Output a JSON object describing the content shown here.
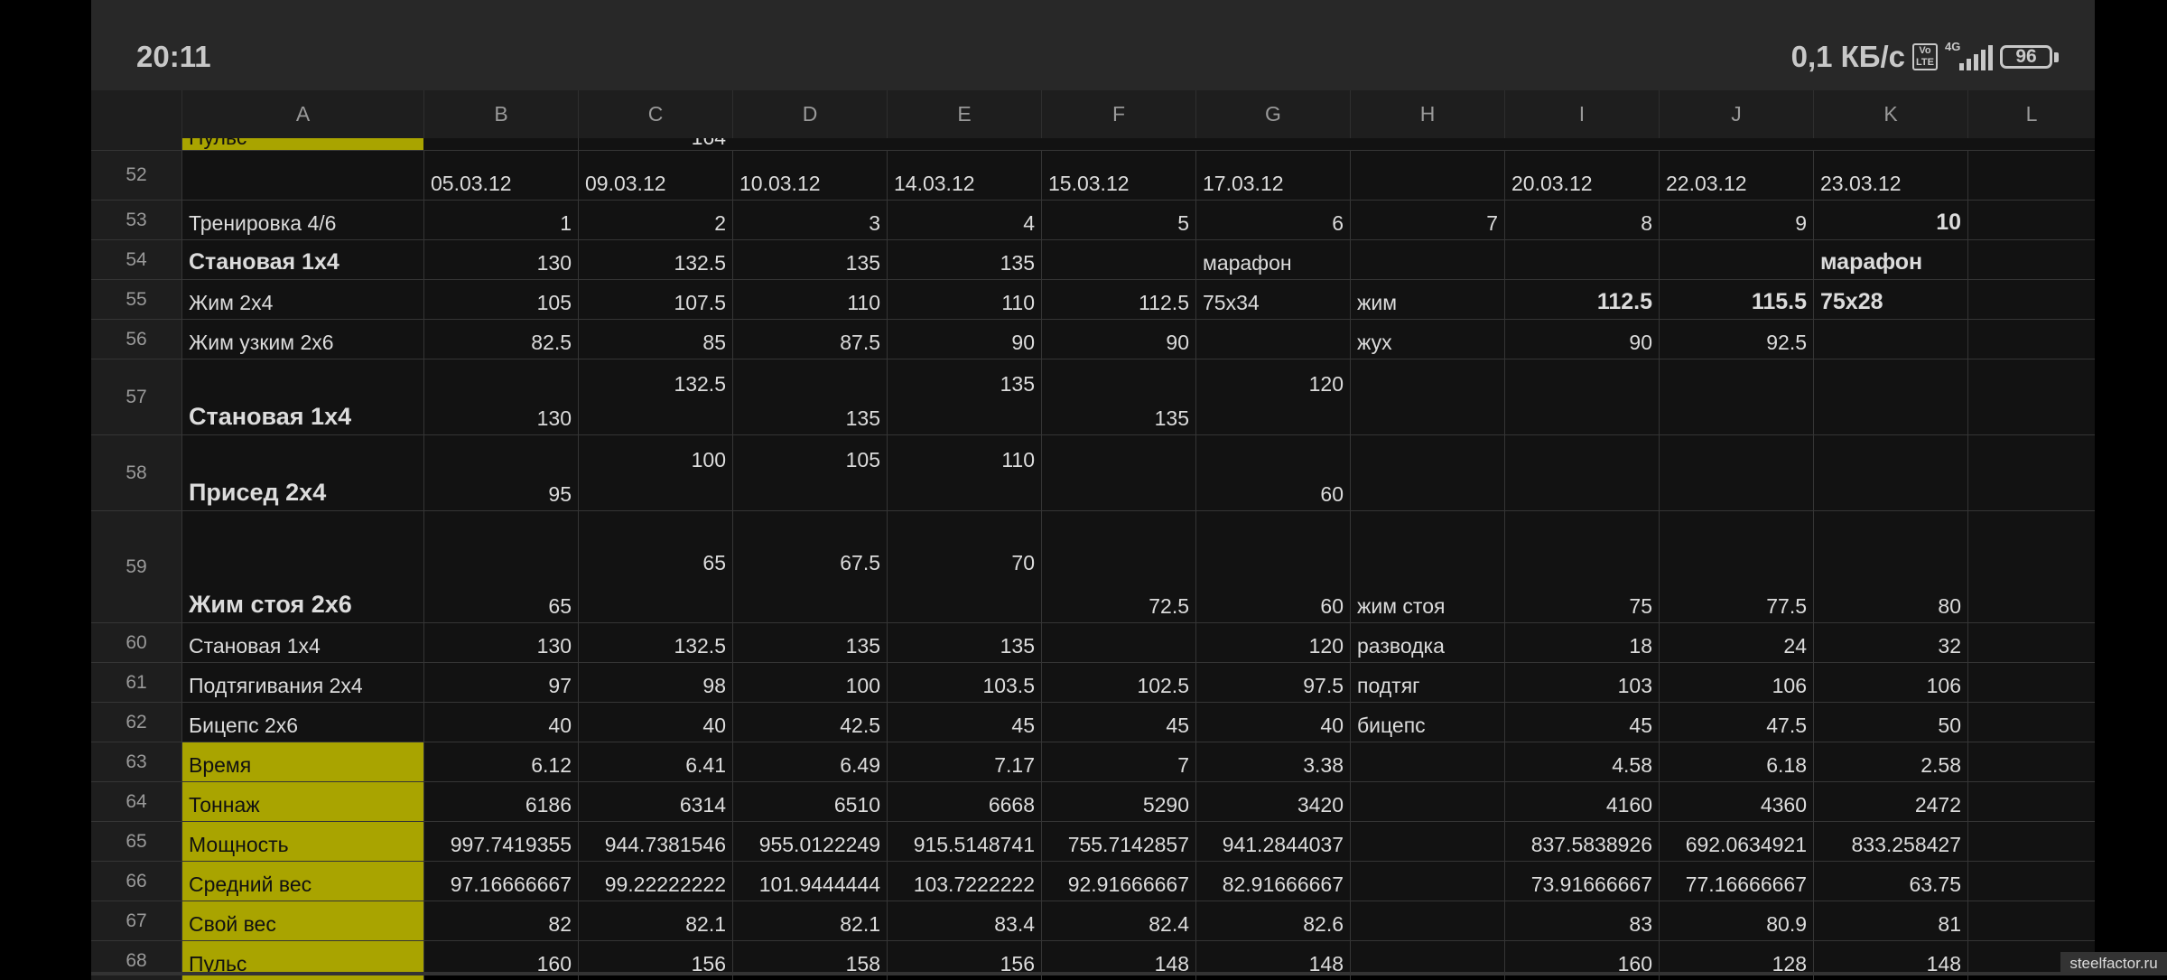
{
  "status": {
    "time": "20:11",
    "net_speed": "0,1 КБ/с",
    "volte": "Vo LTE",
    "network": "4G",
    "battery": "96"
  },
  "sheet": {
    "columns": [
      "A",
      "B",
      "C",
      "D",
      "E",
      "F",
      "G",
      "H",
      "I",
      "J",
      "K",
      "L"
    ],
    "partial_row": {
      "a": "Пульс",
      "c": "164"
    },
    "rows": [
      {
        "num": "52",
        "cells": [
          "",
          "05.03.12",
          "09.03.12",
          "10.03.12",
          "14.03.12",
          "15.03.12",
          "17.03.12",
          "",
          "20.03.12",
          "22.03.12",
          "23.03.12"
        ]
      },
      {
        "num": "53",
        "cells": [
          "Тренировка 4/6",
          "1",
          "2",
          "3",
          "4",
          "5",
          "6",
          "7",
          "8",
          "9",
          "10"
        ]
      },
      {
        "num": "54",
        "cells": [
          "Становая 1х4",
          "130",
          "132.5",
          "135",
          "135",
          "",
          "марафон",
          "",
          "",
          "",
          "марафон"
        ]
      },
      {
        "num": "55",
        "cells": [
          "Жим 2х4",
          "105",
          "107.5",
          "110",
          "110",
          "112.5",
          "75х34",
          "жим",
          "112.5",
          "115.5",
          "75х28"
        ]
      },
      {
        "num": "56",
        "cells": [
          "Жим узким 2х6",
          "82.5",
          "85",
          "87.5",
          "90",
          "90",
          "",
          "жух",
          "90",
          "92.5",
          ""
        ]
      },
      {
        "num": "57",
        "cells": [
          "Становая 1х4",
          "130",
          "132.5",
          "135",
          "135",
          "135",
          "120",
          "",
          "",
          "",
          ""
        ]
      },
      {
        "num": "58",
        "cells": [
          "Присед 2х4",
          "95",
          "100",
          "105",
          "110",
          "",
          "60",
          "",
          "",
          "",
          ""
        ]
      },
      {
        "num": "59",
        "cells": [
          "Жим стоя 2х6",
          "65",
          "65",
          "67.5",
          "70",
          "72.5",
          "60",
          "жим стоя",
          "75",
          "77.5",
          "80"
        ]
      },
      {
        "num": "60",
        "cells": [
          "Становая 1х4",
          "130",
          "132.5",
          "135",
          "135",
          "",
          "120",
          "разводка",
          "18",
          "24",
          "32"
        ]
      },
      {
        "num": "61",
        "cells": [
          "Подтягивания 2х4",
          "97",
          "98",
          "100",
          "103.5",
          "102.5",
          "97.5",
          "подтяг",
          "103",
          "106",
          "106"
        ]
      },
      {
        "num": "62",
        "cells": [
          "Бицепс 2х6",
          "40",
          "40",
          "42.5",
          "45",
          "45",
          "40",
          "бицепс",
          "45",
          "47.5",
          "50"
        ]
      },
      {
        "num": "63",
        "cells": [
          "Время",
          "6.12",
          "6.41",
          "6.49",
          "7.17",
          "7",
          "3.38",
          "",
          "4.58",
          "6.18",
          "2.58"
        ]
      },
      {
        "num": "64",
        "cells": [
          "Тоннаж",
          "6186",
          "6314",
          "6510",
          "6668",
          "5290",
          "3420",
          "",
          "4160",
          "4360",
          "2472"
        ]
      },
      {
        "num": "65",
        "cells": [
          "Мощность",
          "997.7419355",
          "944.7381546",
          "955.0122249",
          "915.5148741",
          "755.7142857",
          "941.2844037",
          "",
          "837.5838926",
          "692.0634921",
          "833.258427"
        ]
      },
      {
        "num": "66",
        "cells": [
          "Средний вес",
          "97.16666667",
          "99.22222222",
          "101.9444444",
          "103.7222222",
          "92.91666667",
          "82.91666667",
          "",
          "73.91666667",
          "77.16666667",
          "63.75"
        ]
      },
      {
        "num": "67",
        "cells": [
          "Свой вес",
          "82",
          "82.1",
          "82.1",
          "83.4",
          "82.4",
          "82.6",
          "",
          "83",
          "80.9",
          "81"
        ]
      },
      {
        "num": "68",
        "cells": [
          "Пульс",
          "160",
          "156",
          "158",
          "156",
          "148",
          "148",
          "",
          "160",
          "128",
          "148"
        ]
      }
    ]
  },
  "watermark": "steelfactor.ru"
}
